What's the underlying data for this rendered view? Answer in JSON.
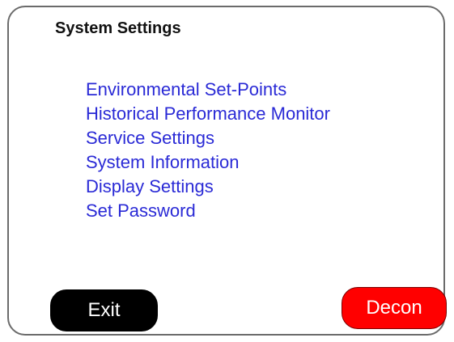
{
  "screen": {
    "title": "System Settings"
  },
  "menu": {
    "items": [
      {
        "label": "Environmental Set-Points"
      },
      {
        "label": "Historical Performance Monitor"
      },
      {
        "label": "Service Settings"
      },
      {
        "label": "System Information"
      },
      {
        "label": "Display Settings"
      },
      {
        "label": "Set Password"
      }
    ]
  },
  "buttons": {
    "exit_label": "Exit",
    "decon_label": "Decon"
  },
  "colors": {
    "link": "#2a2ad6",
    "exit_bg": "#000000",
    "decon_bg": "#ff0000"
  }
}
